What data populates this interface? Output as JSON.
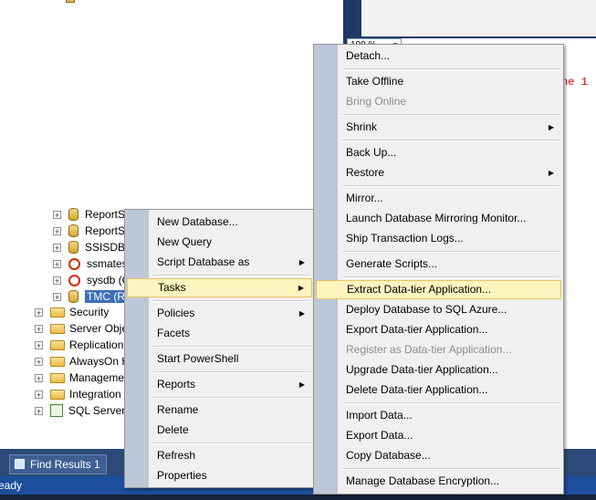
{
  "editor": {
    "zoom_level": "100 %",
    "message_fragment": "ne 1"
  },
  "tree": {
    "databases": [
      {
        "label": "ReportS",
        "state": "normal"
      },
      {
        "label": "ReportS",
        "state": "normal"
      },
      {
        "label": "SSISDB",
        "state": "normal"
      },
      {
        "label": "ssmates",
        "state": "error"
      },
      {
        "label": "sysdb (C",
        "state": "error"
      },
      {
        "label": "TMC (R",
        "state": "selected"
      }
    ],
    "folders": [
      {
        "label": "Security"
      },
      {
        "label": "Server Obje"
      },
      {
        "label": "Replication"
      },
      {
        "label": "AlwaysOn H"
      },
      {
        "label": "Manageme"
      },
      {
        "label": "Integration"
      },
      {
        "label": "SQL Server A"
      }
    ]
  },
  "context_menu": {
    "items": [
      {
        "label": "New Database...",
        "submenu": false
      },
      {
        "label": "New Query",
        "submenu": false
      },
      {
        "label": "Script Database as",
        "submenu": true
      },
      {
        "label": "Tasks",
        "submenu": true,
        "highlighted": true
      },
      {
        "label": "Policies",
        "submenu": true
      },
      {
        "label": "Facets",
        "submenu": false
      },
      {
        "label": "Start PowerShell",
        "submenu": false
      },
      {
        "label": "Reports",
        "submenu": true
      },
      {
        "label": "Rename",
        "submenu": false
      },
      {
        "label": "Delete",
        "submenu": false
      },
      {
        "label": "Refresh",
        "submenu": false
      },
      {
        "label": "Properties",
        "submenu": false
      }
    ]
  },
  "tasks_menu": {
    "items": [
      {
        "label": "Detach...",
        "enabled": true
      },
      {
        "label": "Take Offline",
        "enabled": true
      },
      {
        "label": "Bring Online",
        "enabled": false
      },
      {
        "label": "Shrink",
        "enabled": true,
        "submenu": true
      },
      {
        "label": "Back Up...",
        "enabled": true
      },
      {
        "label": "Restore",
        "enabled": true,
        "submenu": true
      },
      {
        "label": "Mirror...",
        "enabled": true
      },
      {
        "label": "Launch Database Mirroring Monitor...",
        "enabled": true
      },
      {
        "label": "Ship Transaction Logs...",
        "enabled": true
      },
      {
        "label": "Generate Scripts...",
        "enabled": true
      },
      {
        "label": "Extract Data-tier Application...",
        "enabled": true,
        "highlighted": true
      },
      {
        "label": "Deploy Database to SQL Azure...",
        "enabled": true
      },
      {
        "label": "Export Data-tier Application...",
        "enabled": true
      },
      {
        "label": "Register as Data-tier Application...",
        "enabled": false
      },
      {
        "label": "Upgrade Data-tier Application...",
        "enabled": true
      },
      {
        "label": "Delete Data-tier Application...",
        "enabled": true
      },
      {
        "label": "Import Data...",
        "enabled": true
      },
      {
        "label": "Export Data...",
        "enabled": true
      },
      {
        "label": "Copy Database...",
        "enabled": true
      },
      {
        "label": "Manage Database Encryption...",
        "enabled": true
      }
    ]
  },
  "bottom": {
    "find_results_tab": "Find Results 1",
    "status_text": "eady"
  },
  "colors": {
    "menu_highlight": "#fdf4bf",
    "menu_gutter": "#bcc7d8",
    "status_bar": "#1d4e9c",
    "selection": "#3b6fb6"
  }
}
